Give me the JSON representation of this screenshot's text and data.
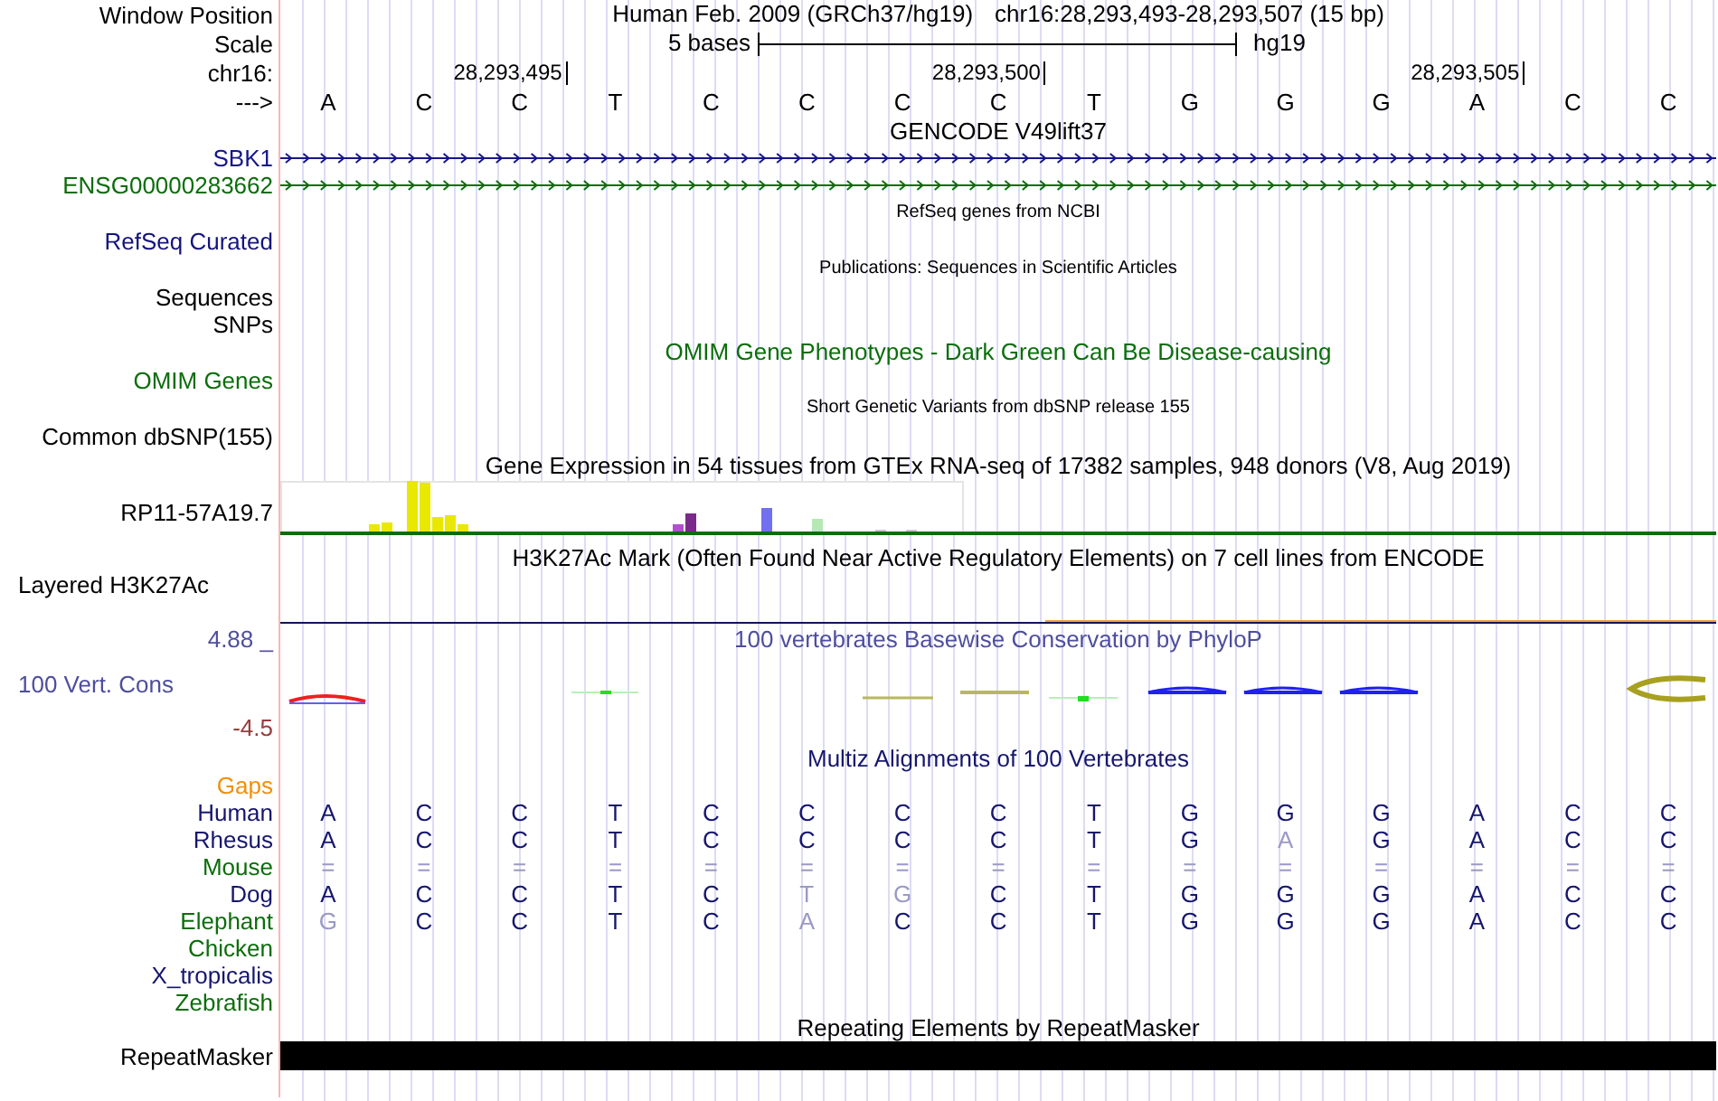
{
  "window_position": {
    "label": "Window Position",
    "assembly": "Human Feb. 2009 (GRCh37/hg19)",
    "position": "chr16:28,293,493-28,293,507 (15 bp)"
  },
  "scale": {
    "label": "Scale",
    "span": "5 bases",
    "assembly": "hg19"
  },
  "ruler": {
    "label": "chr16:",
    "ticks": [
      "28,293,495",
      "28,293,500",
      "28,293,505"
    ]
  },
  "sequence": {
    "label": "--->",
    "bases": [
      "A",
      "C",
      "C",
      "T",
      "C",
      "C",
      "C",
      "C",
      "T",
      "G",
      "G",
      "G",
      "A",
      "C",
      "C"
    ]
  },
  "tracks": [
    {
      "kind": "genes",
      "title": "GENCODE V49lift37",
      "genes": [
        {
          "name": "SBK1",
          "color": "#16168a"
        },
        {
          "name": "ENSG00000283662",
          "color": "#0a6e0a"
        }
      ]
    },
    {
      "kind": "note",
      "title": "RefSeq genes from NCBI",
      "labels": [
        "RefSeq Curated"
      ],
      "color": "#14147e"
    },
    {
      "kind": "note",
      "title": "Publications: Sequences in Scientific Articles",
      "labels": [
        "Sequences",
        "SNPs"
      ],
      "color": "#000000"
    },
    {
      "kind": "empty",
      "title": "OMIM Gene Phenotypes - Dark Green Can Be Disease-causing",
      "labels": [
        "OMIM Genes"
      ],
      "color": "#0a6e0a"
    },
    {
      "kind": "note",
      "title": "Short Genetic Variants from dbSNP release 155",
      "labels": [
        "Common dbSNP(155)"
      ],
      "color": "#000000"
    },
    {
      "kind": "expression",
      "title": "Gene Expression in 54 tissues from GTEx RNA-seq of 17382 samples, 948 donors (V8, Aug 2019)",
      "labels": [
        "RP11-57A19.7"
      ],
      "color": "#000000"
    },
    {
      "kind": "signal",
      "title": "H3K27Ac Mark (Often Found Near Active Regulatory Elements) on 7 cell lines from ENCODE",
      "labels": [
        "Layered H3K27Ac"
      ],
      "color": "#000000"
    },
    {
      "kind": "conservation",
      "title": "100 vertebrates Basewise Conservation by PhyloP",
      "labels": [
        "100 Vert. Cons"
      ],
      "color": "#4e4e9e",
      "y_max": "4.88 _",
      "y_min": "-4.5"
    },
    {
      "kind": "alignment",
      "title": "Multiz Alignments of 100 Vertebrates",
      "gaps_label": "Gaps",
      "rows": [
        {
          "species": "Human",
          "color": "#16166e",
          "bases": [
            {
              "b": "A",
              "match": true
            },
            {
              "b": "C",
              "match": true
            },
            {
              "b": "C",
              "match": true
            },
            {
              "b": "T",
              "match": true
            },
            {
              "b": "C",
              "match": true
            },
            {
              "b": "C",
              "match": true
            },
            {
              "b": "C",
              "match": true
            },
            {
              "b": "C",
              "match": true
            },
            {
              "b": "T",
              "match": true
            },
            {
              "b": "G",
              "match": true
            },
            {
              "b": "G",
              "match": true
            },
            {
              "b": "G",
              "match": true
            },
            {
              "b": "A",
              "match": true
            },
            {
              "b": "C",
              "match": true
            },
            {
              "b": "C",
              "match": true
            }
          ]
        },
        {
          "species": "Rhesus",
          "color": "#16166e",
          "bases": [
            {
              "b": "A",
              "match": true
            },
            {
              "b": "C",
              "match": true
            },
            {
              "b": "C",
              "match": true
            },
            {
              "b": "T",
              "match": true
            },
            {
              "b": "C",
              "match": true
            },
            {
              "b": "C",
              "match": true
            },
            {
              "b": "C",
              "match": true
            },
            {
              "b": "C",
              "match": true
            },
            {
              "b": "T",
              "match": true
            },
            {
              "b": "G",
              "match": true
            },
            {
              "b": "A",
              "match": false
            },
            {
              "b": "G",
              "match": true
            },
            {
              "b": "A",
              "match": true
            },
            {
              "b": "C",
              "match": true
            },
            {
              "b": "C",
              "match": true
            }
          ]
        },
        {
          "species": "Mouse",
          "color": "#0a6e0a",
          "bases": [
            {
              "b": "=",
              "match": false
            },
            {
              "b": "=",
              "match": false
            },
            {
              "b": "=",
              "match": false
            },
            {
              "b": "=",
              "match": false
            },
            {
              "b": "=",
              "match": false
            },
            {
              "b": "=",
              "match": false
            },
            {
              "b": "=",
              "match": false
            },
            {
              "b": "=",
              "match": false
            },
            {
              "b": "=",
              "match": false
            },
            {
              "b": "=",
              "match": false
            },
            {
              "b": "=",
              "match": false
            },
            {
              "b": "=",
              "match": false
            },
            {
              "b": "=",
              "match": false
            },
            {
              "b": "=",
              "match": false
            },
            {
              "b": "=",
              "match": false
            }
          ]
        },
        {
          "species": "Dog",
          "color": "#16166e",
          "bases": [
            {
              "b": "A",
              "match": true
            },
            {
              "b": "C",
              "match": true
            },
            {
              "b": "C",
              "match": true
            },
            {
              "b": "T",
              "match": true
            },
            {
              "b": "C",
              "match": true
            },
            {
              "b": "T",
              "match": false
            },
            {
              "b": "G",
              "match": false
            },
            {
              "b": "C",
              "match": true
            },
            {
              "b": "T",
              "match": true
            },
            {
              "b": "G",
              "match": true
            },
            {
              "b": "G",
              "match": true
            },
            {
              "b": "G",
              "match": true
            },
            {
              "b": "A",
              "match": true
            },
            {
              "b": "C",
              "match": true
            },
            {
              "b": "C",
              "match": true
            }
          ]
        },
        {
          "species": "Elephant",
          "color": "#0a6e0a",
          "bases": [
            {
              "b": "G",
              "match": false
            },
            {
              "b": "C",
              "match": true
            },
            {
              "b": "C",
              "match": true
            },
            {
              "b": "T",
              "match": true
            },
            {
              "b": "C",
              "match": true
            },
            {
              "b": "A",
              "match": false
            },
            {
              "b": "C",
              "match": true
            },
            {
              "b": "C",
              "match": true
            },
            {
              "b": "T",
              "match": true
            },
            {
              "b": "G",
              "match": true
            },
            {
              "b": "G",
              "match": true
            },
            {
              "b": "G",
              "match": true
            },
            {
              "b": "A",
              "match": true
            },
            {
              "b": "C",
              "match": true
            },
            {
              "b": "C",
              "match": true
            }
          ]
        },
        {
          "species": "Chicken",
          "color": "#0a6e0a"
        },
        {
          "species": "X_tropicalis",
          "color": "#16166e"
        },
        {
          "species": "Zebrafish",
          "color": "#0a6e0a"
        }
      ]
    },
    {
      "kind": "repeats",
      "title": "Repeating Elements by RepeatMasker",
      "labels": [
        "RepeatMasker"
      ],
      "color": "#000000"
    }
  ]
}
